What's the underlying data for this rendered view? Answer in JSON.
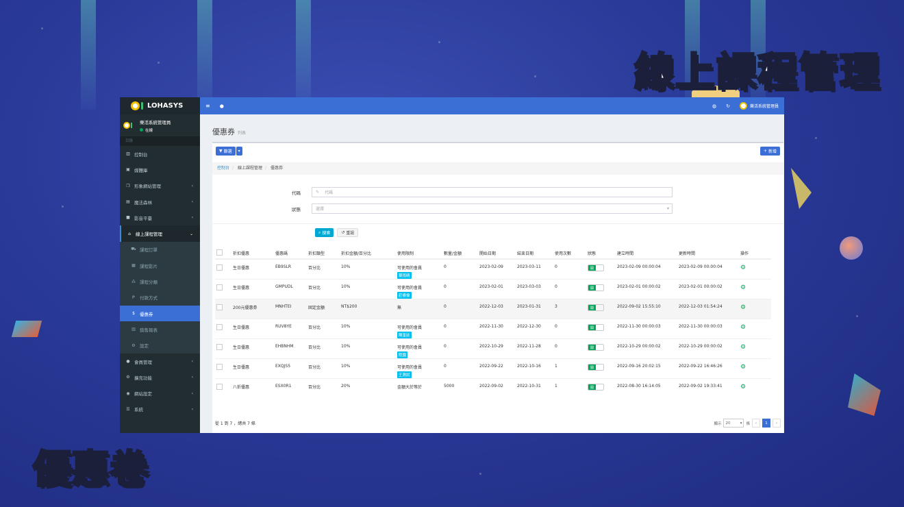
{
  "overlay": {
    "title": "線上課程管理",
    "subtitle": "優惠卷"
  },
  "brand": {
    "name": "LOHASYS"
  },
  "user": {
    "name": "樂活系統管理員",
    "status": "在線"
  },
  "sidebar": {
    "section": "目錄",
    "items": [
      {
        "label": "控制台",
        "icon": "bar-chart-icon"
      },
      {
        "label": "媒體庫",
        "icon": "file-image-icon"
      },
      {
        "label": "形象網站管理",
        "icon": "clone-icon",
        "chevron": true
      },
      {
        "label": "魔法森林",
        "icon": "book-icon",
        "chevron": true
      },
      {
        "label": "影音平臺",
        "icon": "video-icon",
        "chevron": true
      },
      {
        "label": "線上課程管理",
        "icon": "bank-icon",
        "open": true
      }
    ],
    "subitems": [
      {
        "label": "課程訂單",
        "icon": "cart-icon"
      },
      {
        "label": "課程影片",
        "icon": "film-icon"
      },
      {
        "label": "課程分類",
        "icon": "sitemap-icon"
      },
      {
        "label": "付款方式",
        "icon": "paypal-icon"
      },
      {
        "label": "優惠券",
        "icon": "dollar-icon",
        "active": true
      },
      {
        "label": "銷售報表",
        "icon": "bar-chart-icon"
      },
      {
        "label": "設定",
        "icon": "cogs-icon"
      }
    ],
    "items2": [
      {
        "label": "會員管理",
        "icon": "user-icon"
      },
      {
        "label": "擴充功能",
        "icon": "cogs-icon"
      },
      {
        "label": "網站設定",
        "icon": "globe-icon"
      },
      {
        "label": "系統",
        "icon": "list-icon"
      }
    ]
  },
  "topbar": {
    "user": "樂活系統管理員"
  },
  "page": {
    "title": "優惠券",
    "subtitle": "列表"
  },
  "toolbar": {
    "filter_label": "篩選",
    "new_label": "新增"
  },
  "breadcrumb": [
    "控制台",
    "線上課程管理",
    "優惠券"
  ],
  "filters": {
    "code_label": "代碼",
    "code_placeholder": "代碼",
    "status_label": "狀態",
    "status_value": "選擇",
    "search_label": "搜索",
    "reset_label": "重設"
  },
  "table": {
    "headers": [
      "折扣優惠",
      "優惠碼",
      "折扣類型",
      "折扣金額/百分比",
      "使用限制",
      "數量/金額",
      "開始日期",
      "結束日期",
      "使用次數",
      "狀態",
      "建立時間",
      "更新時間",
      "操作"
    ],
    "rows": [
      {
        "name": "生日優惠",
        "code": "EB9SLR",
        "type": "百分比",
        "amount": "10%",
        "limit": "可使用的會員",
        "tag": "葉雨晴",
        "qty": "0",
        "start": "2023-02-09",
        "end": "2023-03-11",
        "used": "0",
        "created": "2023-02-09 00:00:04",
        "updated": "2023-02-09 00:00:04"
      },
      {
        "name": "生日優惠",
        "code": "GMPUDL",
        "type": "百分比",
        "amount": "10%",
        "limit": "可使用的會員",
        "tag": "莊睿倫",
        "qty": "0",
        "start": "2023-02-01",
        "end": "2023-03-03",
        "used": "0",
        "created": "2023-02-01 00:00:02",
        "updated": "2023-02-01 00:00:02"
      },
      {
        "name": "200元優惠券",
        "code": "MNHTEI",
        "type": "固定金額",
        "amount": "NT$200",
        "limit": "無",
        "tag": "",
        "qty": "0",
        "start": "2022-12-03",
        "end": "2023-01-31",
        "used": "3",
        "created": "2022-09-02 15:55:10",
        "updated": "2022-12-03 01:54:24"
      },
      {
        "name": "生日優惠",
        "code": "RUV8YE",
        "type": "百分比",
        "amount": "10%",
        "limit": "可使用的會員",
        "tag": "陳奎廷",
        "qty": "0",
        "start": "2022-11-30",
        "end": "2022-12-30",
        "used": "0",
        "created": "2022-11-30 00:00:03",
        "updated": "2022-11-30 00:00:03"
      },
      {
        "name": "生日優惠",
        "code": "EHBNHM",
        "type": "百分比",
        "amount": "10%",
        "limit": "可使用的會員",
        "tag": "陸園",
        "qty": "0",
        "start": "2022-10-29",
        "end": "2022-11-28",
        "used": "0",
        "created": "2022-10-29 00:00:02",
        "updated": "2022-10-29 00:00:02"
      },
      {
        "name": "生日優惠",
        "code": "EXQJS5",
        "type": "百分比",
        "amount": "10%",
        "limit": "可使用的會員",
        "tag": "王測試",
        "qty": "0",
        "start": "2022-09-22",
        "end": "2022-10-16",
        "used": "1",
        "created": "2022-09-16 20:02:15",
        "updated": "2022-09-22 16:46:26"
      },
      {
        "name": "八折優惠",
        "code": "ESX0R1",
        "type": "百分比",
        "amount": "20%",
        "limit": "金額大於等於",
        "tag": "",
        "qty": "5000",
        "start": "2022-09-02",
        "end": "2022-10-31",
        "used": "1",
        "created": "2022-08-30 16:14:05",
        "updated": "2022-09-02 19:33:41"
      }
    ],
    "toggle_label": "開"
  },
  "footer": {
    "summary": "從 1 到 7 ，總共 7 條",
    "show_label": "顯示",
    "per_page": "20",
    "unit": "條",
    "prev": "‹",
    "page": "1",
    "next": "›"
  }
}
